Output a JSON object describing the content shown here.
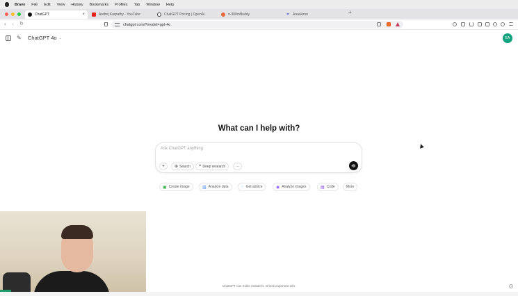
{
  "menubar": {
    "app_name": "Brave",
    "items": [
      "File",
      "Edit",
      "View",
      "History",
      "Bookmarks",
      "Profiles",
      "Tab",
      "Window",
      "Help"
    ]
  },
  "tabs": [
    {
      "label": "ChatGPT",
      "favicon": "chatgpt-icon",
      "color": "#111111",
      "active": true
    },
    {
      "label": "Andrej Karpathy - YouTube",
      "favicon": "youtube-icon",
      "color": "#e62117",
      "active": false
    },
    {
      "label": "ChatGPT Pricing | OpenAI",
      "favicon": "openai-icon",
      "color": "#333333",
      "active": false
    },
    {
      "label": "o-300mBuddy",
      "favicon": "circle-icon",
      "color": "#ea6b3a",
      "active": false
    },
    {
      "label": "Anaskimo",
      "favicon": "x-icon",
      "color": "#4a5bd3",
      "active": false
    }
  ],
  "toolbar": {
    "url": "chatgpt.com/?model=gpt-4o"
  },
  "header": {
    "model_label": "ChatGPT 4o",
    "avatar_initials": "EA",
    "avatar_color": "#10a37f"
  },
  "main": {
    "headline": "What can I help with?",
    "composer": {
      "placeholder": "Ask ChatGPT anything",
      "buttons": [
        {
          "label": "Search",
          "icon": "globe-icon"
        },
        {
          "label": "Deep research",
          "icon": "telescope-icon"
        }
      ]
    },
    "chips": [
      {
        "label": "Create image",
        "icon": "image-icon",
        "color": "#35ae47"
      },
      {
        "label": "Analyze data",
        "icon": "chart-icon",
        "color": "#3b82f6"
      },
      {
        "label": "Get advice",
        "icon": "lightbulb-icon",
        "color": "#06b6d4"
      },
      {
        "label": "Analyze images",
        "icon": "eye-icon",
        "color": "#8b5cf6"
      },
      {
        "label": "Code",
        "icon": "code-icon",
        "color": "#7c3aed"
      },
      {
        "label": "More",
        "icon": "",
        "color": "#555555"
      }
    ]
  },
  "footer": {
    "note": "ChatGPT can make mistakes. Check important info.",
    "help": "?"
  }
}
